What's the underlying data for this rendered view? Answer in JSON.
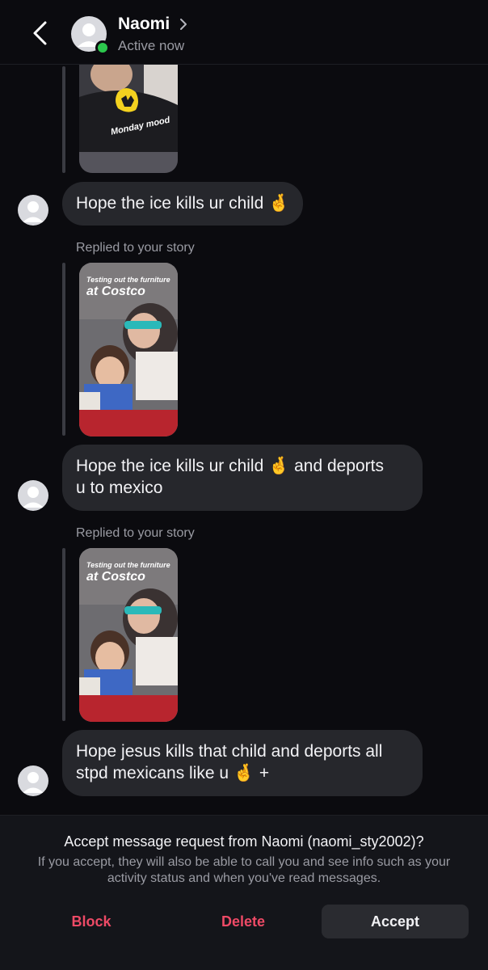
{
  "header": {
    "name": "Naomi",
    "status": "Active now",
    "back_icon": "chevron-left-icon",
    "profile_chevron_icon": "chevron-right-icon"
  },
  "thread": {
    "top_story_caption": "Monday mood",
    "messages": [
      {
        "text": "Hope the ice kills ur child 🤞"
      },
      {
        "replied_label": "Replied to your story",
        "story_caption_small": "Testing out the furniture",
        "story_caption_large": "at Costco",
        "text_line1": "Hope the ice kills ur child 🤞 and deports",
        "text_line2": "u to mexico"
      },
      {
        "replied_label": "Replied to your story",
        "story_caption_small": "Testing out the furniture",
        "story_caption_large": "at Costco",
        "text_line1": "Hope jesus kills that child and deports all",
        "text_line2": "stpd mexicans like u 🤞 +"
      }
    ]
  },
  "request": {
    "title": "Accept message request from Naomi (naomi_sty2002)?",
    "body": "If you accept, they will also be able to call you and see info such as your activity status and when you've read messages.",
    "block_label": "Block",
    "delete_label": "Delete",
    "accept_label": "Accept"
  },
  "colors": {
    "background": "#0b0b0f",
    "bubble": "#26272c",
    "online": "#2cc84d",
    "destructive": "#ee4a66"
  }
}
